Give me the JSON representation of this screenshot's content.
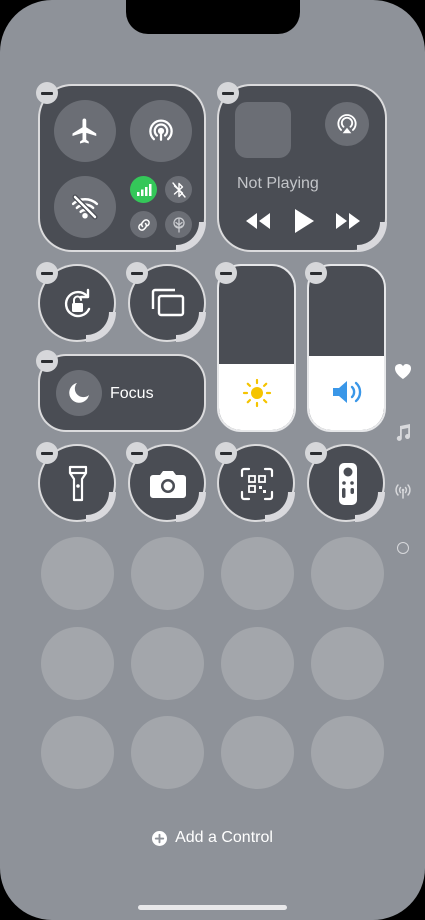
{
  "media": {
    "status": "Not Playing"
  },
  "focus": {
    "label": "Focus"
  },
  "footer": {
    "add_control_label": "Add a Control"
  },
  "colors": {
    "screen_bg": "#8e9299",
    "tile_bg": "#4a4d54",
    "cellular_green": "#34c759",
    "brightness_sun": "#f5c400",
    "volume_blue": "#3a97e8"
  },
  "icons": {
    "airplane": "airplane-icon",
    "airdrop": "airdrop-icon",
    "wifi_off": "wifi-off-icon",
    "cellular": "cellular-icon",
    "bluetooth_off": "bluetooth-off-icon",
    "airplay": "airplay-icon",
    "rotation_lock": "rotation-lock-icon",
    "screen_mirroring": "screen-mirroring-icon",
    "moon": "moon-icon",
    "flashlight": "flashlight-icon",
    "camera": "camera-icon",
    "qr_scanner": "qr-scanner-icon",
    "remote": "remote-icon"
  },
  "sliders": {
    "brightness_level": 0.4,
    "volume_level": 0.45
  }
}
